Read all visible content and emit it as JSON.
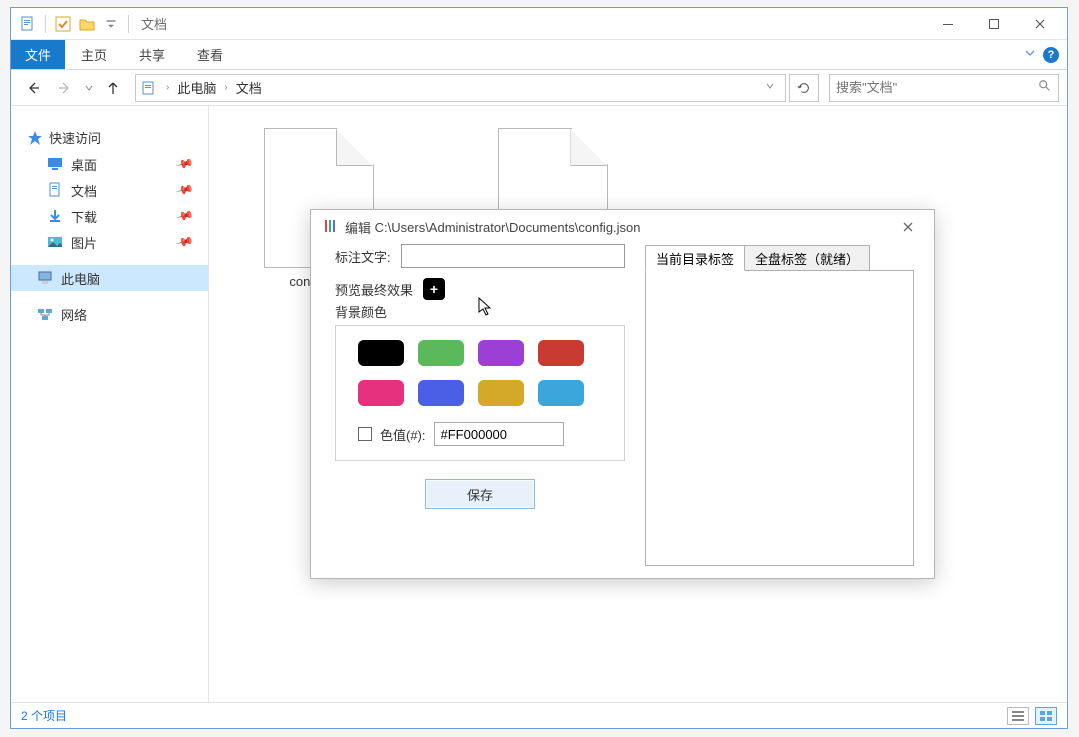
{
  "window": {
    "title": "文档"
  },
  "ribbon": {
    "file_tab": "文件",
    "tabs": [
      "主页",
      "共享",
      "查看"
    ]
  },
  "address": {
    "parts": [
      "此电脑",
      "文档"
    ]
  },
  "search": {
    "placeholder": "搜索\"文档\""
  },
  "nav": {
    "quick_access": "快速访问",
    "items": [
      {
        "label": "桌面",
        "icon": "desktop",
        "pinned": true
      },
      {
        "label": "文档",
        "icon": "document",
        "pinned": true
      },
      {
        "label": "下载",
        "icon": "download",
        "pinned": true
      },
      {
        "label": "图片",
        "icon": "picture",
        "pinned": true
      }
    ],
    "this_pc": "此电脑",
    "network": "网络"
  },
  "files": [
    {
      "name": "config.bac"
    },
    {
      "name": ""
    }
  ],
  "statusbar": {
    "text": "2 个项目"
  },
  "dialog": {
    "title_prefix": "编辑",
    "path": "C:\\Users\\Administrator\\Documents\\config.json",
    "label_text": "标注文字:",
    "label_value": "",
    "preview_label": "预览最终效果",
    "bg_label": "背景颜色",
    "swatches": [
      "#000000",
      "#5bb85b",
      "#9c3fd4",
      "#c83a32",
      "#e6317e",
      "#4a5ee6",
      "#d4a829",
      "#3aa6dc"
    ],
    "hex_label": "色值(#):",
    "hex_value": "#FF000000",
    "save_label": "保存",
    "tabs": {
      "current": "当前目录标签",
      "all": "全盘标签（就绪）"
    }
  }
}
